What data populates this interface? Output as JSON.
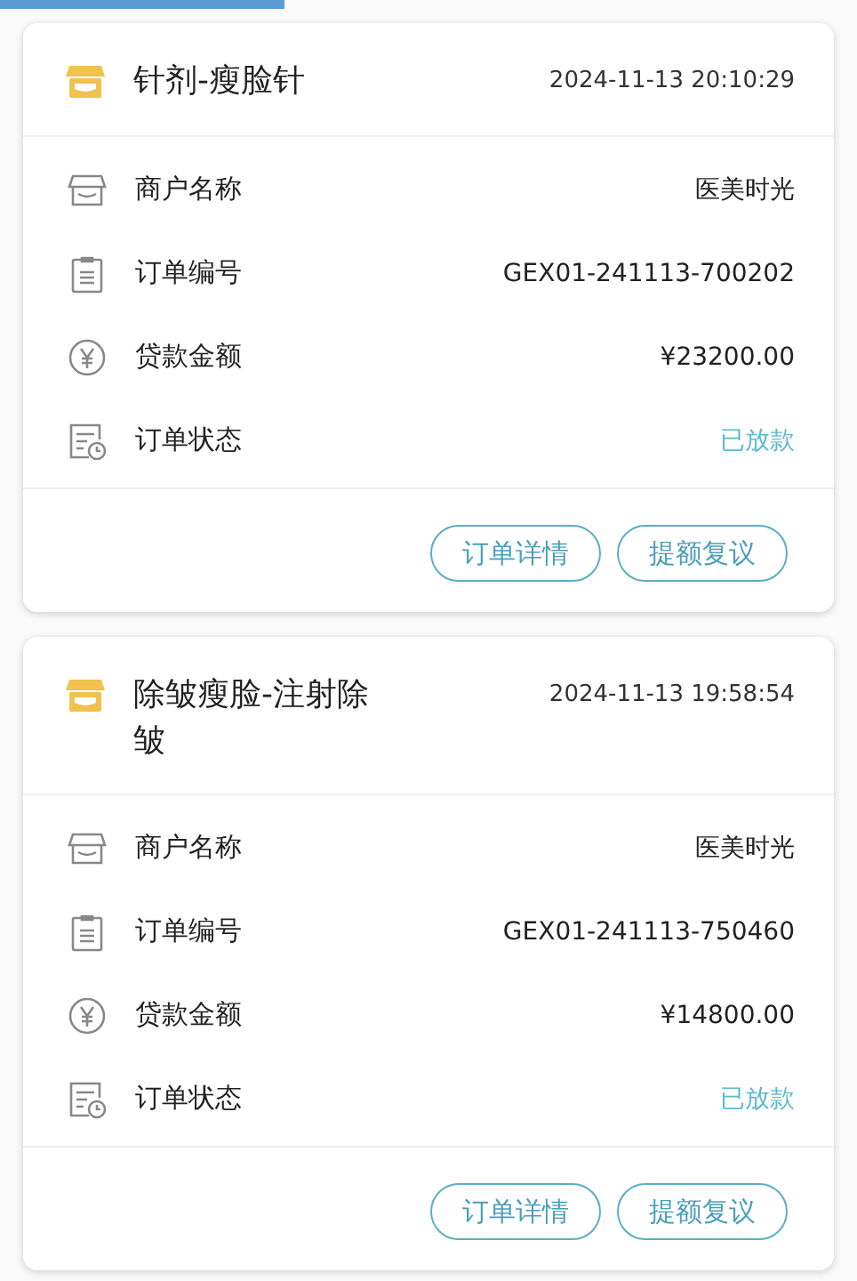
{
  "orders": [
    {
      "title": "针剂-瘦脸针",
      "time": "2024-11-13 20:10:29",
      "fields": [
        {
          "kind": "merchant",
          "label": "商户名称",
          "value": "医美时光"
        },
        {
          "kind": "order_no",
          "label": "订单编号",
          "value": "GEX01-241113-700202"
        },
        {
          "kind": "amount",
          "label": "贷款金额",
          "value": "¥23200.00"
        },
        {
          "kind": "status",
          "label": "订单状态",
          "value": "已放款"
        }
      ],
      "buttons": [
        "订单详情",
        "提额复议"
      ]
    },
    {
      "title": "除皱瘦脸-注射除皱",
      "time": "2024-11-13 19:58:54",
      "fields": [
        {
          "kind": "merchant",
          "label": "商户名称",
          "value": "医美时光"
        },
        {
          "kind": "order_no",
          "label": "订单编号",
          "value": "GEX01-241113-750460"
        },
        {
          "kind": "amount",
          "label": "贷款金额",
          "value": "¥14800.00"
        },
        {
          "kind": "status",
          "label": "订单状态",
          "value": "已放款"
        }
      ],
      "buttons": [
        "订单详情",
        "提额复议"
      ]
    }
  ]
}
